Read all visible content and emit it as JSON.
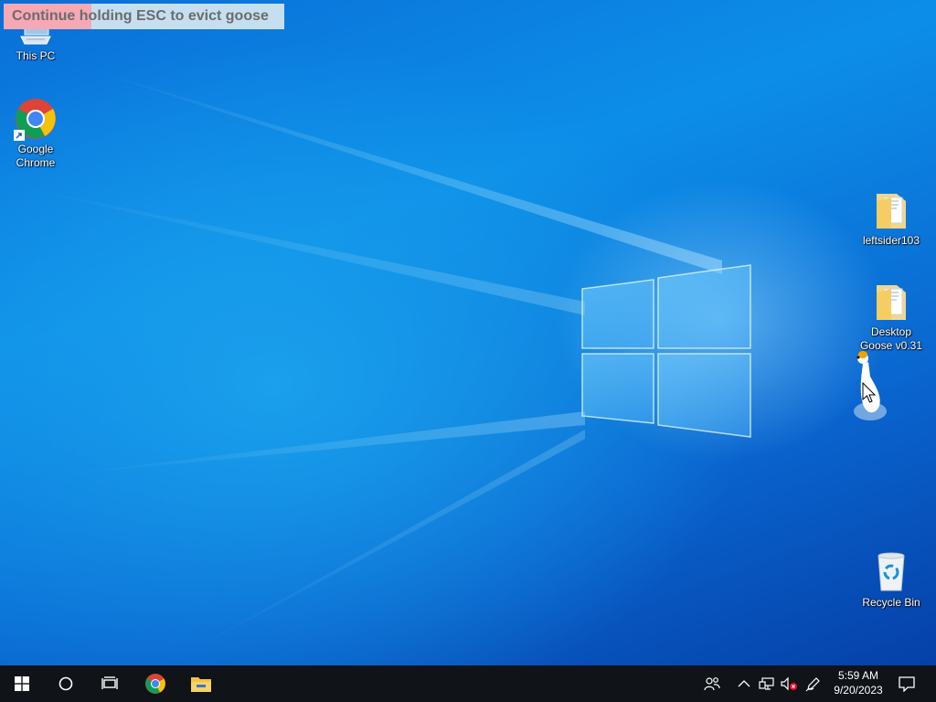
{
  "banner": {
    "text": "Continue holding ESC to evict goose",
    "hold_progress": 0.3
  },
  "desktop_icons": {
    "this_pc": {
      "label": "This PC",
      "icon": "this-pc-icon"
    },
    "chrome": {
      "label1": "Google",
      "label2": "Chrome",
      "icon": "chrome-icon"
    },
    "folder1": {
      "label": "leftsider103",
      "icon": "folder-icon"
    },
    "folder2": {
      "label1": "Desktop",
      "label2": "Goose v0.31",
      "icon": "folder-icon"
    },
    "recycle": {
      "label": "Recycle Bin",
      "icon": "recycle-bin-icon"
    }
  },
  "taskbar": {
    "time": "5:59 AM",
    "date": "9/20/2023",
    "buttons": [
      "start-button",
      "search-button",
      "task-view-button",
      "chrome-taskbar-button",
      "file-explorer-taskbar-button"
    ],
    "tray": [
      "people-icon",
      "show-hidden-icons",
      "network-icon",
      "volume-muted-icon",
      "pen-workspace-icon",
      "notifications-icon"
    ]
  },
  "colors": {
    "desktop_accent": "#0a78dc",
    "taskbar": "#101418",
    "banner_progress": "#f6a8b4",
    "banner_bg": "#c6dff0"
  }
}
